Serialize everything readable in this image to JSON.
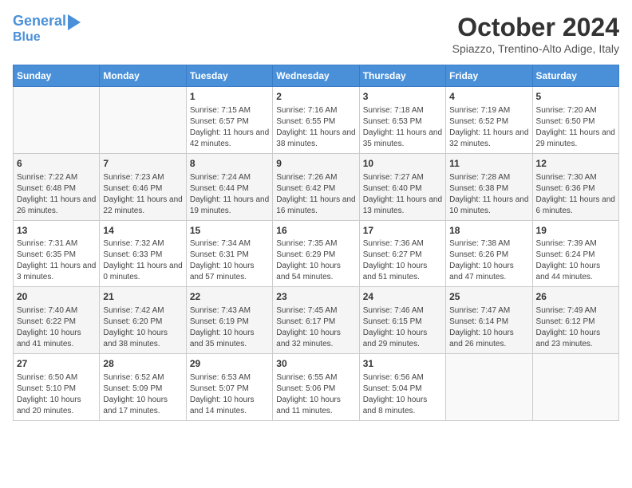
{
  "header": {
    "logo_line1": "General",
    "logo_line2": "Blue",
    "month": "October 2024",
    "location": "Spiazzo, Trentino-Alto Adige, Italy"
  },
  "weekdays": [
    "Sunday",
    "Monday",
    "Tuesday",
    "Wednesday",
    "Thursday",
    "Friday",
    "Saturday"
  ],
  "weeks": [
    [
      {
        "day": "",
        "info": ""
      },
      {
        "day": "",
        "info": ""
      },
      {
        "day": "1",
        "info": "Sunrise: 7:15 AM\nSunset: 6:57 PM\nDaylight: 11 hours and 42 minutes."
      },
      {
        "day": "2",
        "info": "Sunrise: 7:16 AM\nSunset: 6:55 PM\nDaylight: 11 hours and 38 minutes."
      },
      {
        "day": "3",
        "info": "Sunrise: 7:18 AM\nSunset: 6:53 PM\nDaylight: 11 hours and 35 minutes."
      },
      {
        "day": "4",
        "info": "Sunrise: 7:19 AM\nSunset: 6:52 PM\nDaylight: 11 hours and 32 minutes."
      },
      {
        "day": "5",
        "info": "Sunrise: 7:20 AM\nSunset: 6:50 PM\nDaylight: 11 hours and 29 minutes."
      }
    ],
    [
      {
        "day": "6",
        "info": "Sunrise: 7:22 AM\nSunset: 6:48 PM\nDaylight: 11 hours and 26 minutes."
      },
      {
        "day": "7",
        "info": "Sunrise: 7:23 AM\nSunset: 6:46 PM\nDaylight: 11 hours and 22 minutes."
      },
      {
        "day": "8",
        "info": "Sunrise: 7:24 AM\nSunset: 6:44 PM\nDaylight: 11 hours and 19 minutes."
      },
      {
        "day": "9",
        "info": "Sunrise: 7:26 AM\nSunset: 6:42 PM\nDaylight: 11 hours and 16 minutes."
      },
      {
        "day": "10",
        "info": "Sunrise: 7:27 AM\nSunset: 6:40 PM\nDaylight: 11 hours and 13 minutes."
      },
      {
        "day": "11",
        "info": "Sunrise: 7:28 AM\nSunset: 6:38 PM\nDaylight: 11 hours and 10 minutes."
      },
      {
        "day": "12",
        "info": "Sunrise: 7:30 AM\nSunset: 6:36 PM\nDaylight: 11 hours and 6 minutes."
      }
    ],
    [
      {
        "day": "13",
        "info": "Sunrise: 7:31 AM\nSunset: 6:35 PM\nDaylight: 11 hours and 3 minutes."
      },
      {
        "day": "14",
        "info": "Sunrise: 7:32 AM\nSunset: 6:33 PM\nDaylight: 11 hours and 0 minutes."
      },
      {
        "day": "15",
        "info": "Sunrise: 7:34 AM\nSunset: 6:31 PM\nDaylight: 10 hours and 57 minutes."
      },
      {
        "day": "16",
        "info": "Sunrise: 7:35 AM\nSunset: 6:29 PM\nDaylight: 10 hours and 54 minutes."
      },
      {
        "day": "17",
        "info": "Sunrise: 7:36 AM\nSunset: 6:27 PM\nDaylight: 10 hours and 51 minutes."
      },
      {
        "day": "18",
        "info": "Sunrise: 7:38 AM\nSunset: 6:26 PM\nDaylight: 10 hours and 47 minutes."
      },
      {
        "day": "19",
        "info": "Sunrise: 7:39 AM\nSunset: 6:24 PM\nDaylight: 10 hours and 44 minutes."
      }
    ],
    [
      {
        "day": "20",
        "info": "Sunrise: 7:40 AM\nSunset: 6:22 PM\nDaylight: 10 hours and 41 minutes."
      },
      {
        "day": "21",
        "info": "Sunrise: 7:42 AM\nSunset: 6:20 PM\nDaylight: 10 hours and 38 minutes."
      },
      {
        "day": "22",
        "info": "Sunrise: 7:43 AM\nSunset: 6:19 PM\nDaylight: 10 hours and 35 minutes."
      },
      {
        "day": "23",
        "info": "Sunrise: 7:45 AM\nSunset: 6:17 PM\nDaylight: 10 hours and 32 minutes."
      },
      {
        "day": "24",
        "info": "Sunrise: 7:46 AM\nSunset: 6:15 PM\nDaylight: 10 hours and 29 minutes."
      },
      {
        "day": "25",
        "info": "Sunrise: 7:47 AM\nSunset: 6:14 PM\nDaylight: 10 hours and 26 minutes."
      },
      {
        "day": "26",
        "info": "Sunrise: 7:49 AM\nSunset: 6:12 PM\nDaylight: 10 hours and 23 minutes."
      }
    ],
    [
      {
        "day": "27",
        "info": "Sunrise: 6:50 AM\nSunset: 5:10 PM\nDaylight: 10 hours and 20 minutes."
      },
      {
        "day": "28",
        "info": "Sunrise: 6:52 AM\nSunset: 5:09 PM\nDaylight: 10 hours and 17 minutes."
      },
      {
        "day": "29",
        "info": "Sunrise: 6:53 AM\nSunset: 5:07 PM\nDaylight: 10 hours and 14 minutes."
      },
      {
        "day": "30",
        "info": "Sunrise: 6:55 AM\nSunset: 5:06 PM\nDaylight: 10 hours and 11 minutes."
      },
      {
        "day": "31",
        "info": "Sunrise: 6:56 AM\nSunset: 5:04 PM\nDaylight: 10 hours and 8 minutes."
      },
      {
        "day": "",
        "info": ""
      },
      {
        "day": "",
        "info": ""
      }
    ]
  ]
}
